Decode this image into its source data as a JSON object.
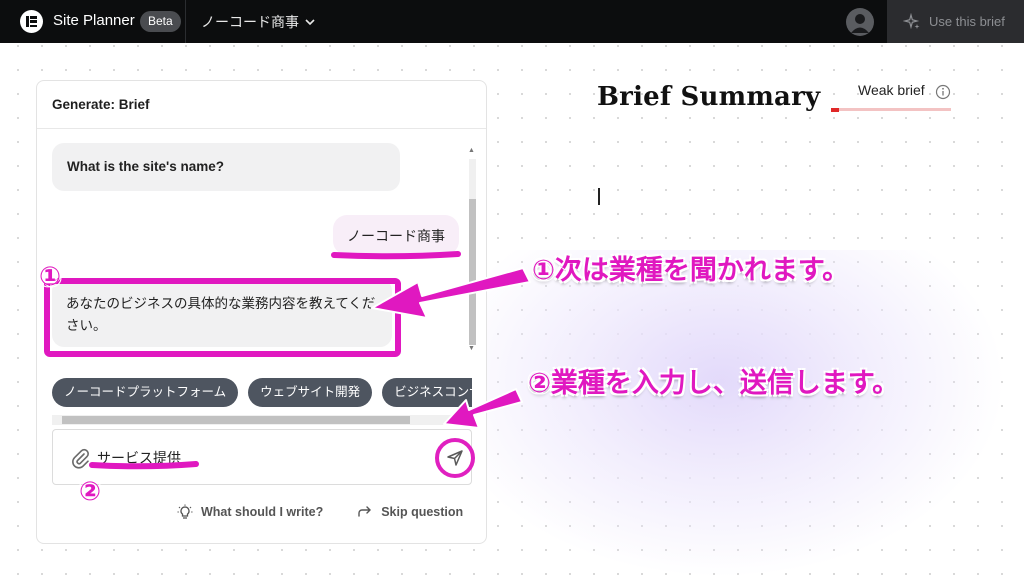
{
  "topbar": {
    "app_title": "Site Planner",
    "beta_badge": "Beta",
    "site_name": "ノーコード商事",
    "use_brief": "Use this brief"
  },
  "panel": {
    "header": "Generate: Brief",
    "messages": {
      "ai_question": "What is the site's name?",
      "user_answer": "ノーコード商事",
      "ai_followup": "あなたのビジネスの具体的な業務内容を教えてください。"
    },
    "chips": [
      "ノーコードプラットフォーム",
      "ウェブサイト開発",
      "ビジネスコンサルティング"
    ],
    "input": {
      "value": "サービス提供"
    },
    "footer": {
      "what_to_write": "What should I write?",
      "skip": "Skip question"
    }
  },
  "summary": {
    "title": "Brief Summary",
    "strength_label": "Weak brief",
    "strength_level": 0.07
  },
  "annotations": {
    "step1_marker": "①",
    "step1_text": "①次は業種を聞かれます。",
    "step2_marker": "②",
    "step2_text": "②業種を入力し、送信します。"
  },
  "colors": {
    "highlight": "#e018c0",
    "topbar_bg": "#0c0d0e",
    "chip_bg": "#4e5560",
    "weak_bar": "#e02828"
  }
}
